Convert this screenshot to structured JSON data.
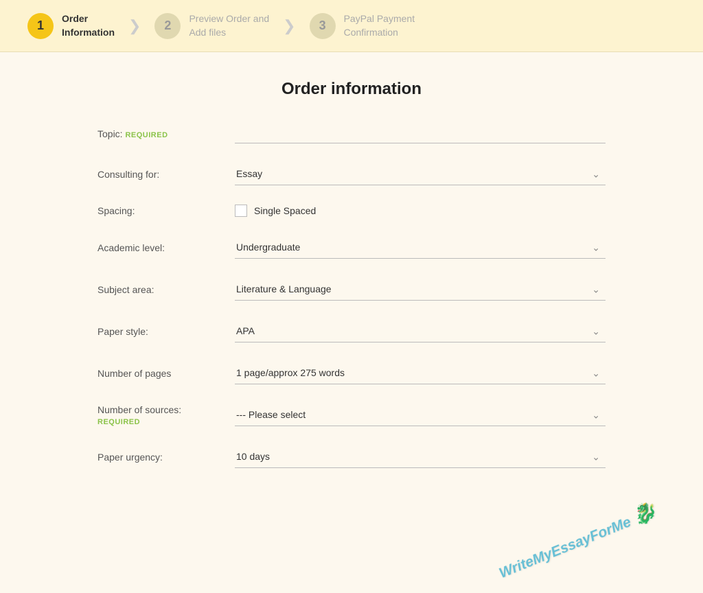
{
  "steps": [
    {
      "number": "1",
      "label_line1": "Order",
      "label_line2": "Information",
      "state": "active"
    },
    {
      "number": "2",
      "label_line1": "Preview Order and",
      "label_line2": "Add files",
      "state": "inactive"
    },
    {
      "number": "3",
      "label_line1": "PayPal Payment",
      "label_line2": "Confirmation",
      "state": "inactive"
    }
  ],
  "form": {
    "title": "Order information",
    "fields": {
      "topic_label": "Topic:",
      "topic_required": "REQUIRED",
      "topic_value": "",
      "consulting_label": "Consulting for:",
      "consulting_value": "Essay",
      "spacing_label": "Spacing:",
      "spacing_checkbox_label": "Single Spaced",
      "spacing_checked": false,
      "academic_label": "Academic level:",
      "academic_value": "Undergraduate",
      "subject_label": "Subject area:",
      "subject_value": "Literature & Language",
      "paper_style_label": "Paper style:",
      "paper_style_value": "APA",
      "pages_label": "Number of pages",
      "pages_value": "1 page/approx 275 words",
      "sources_label": "Number of sources:",
      "sources_required": "REQUIRED",
      "sources_value": "--- Please select",
      "urgency_label": "Paper urgency:",
      "urgency_value": "10 days"
    }
  },
  "watermark": "WriteMyEssayForMe"
}
